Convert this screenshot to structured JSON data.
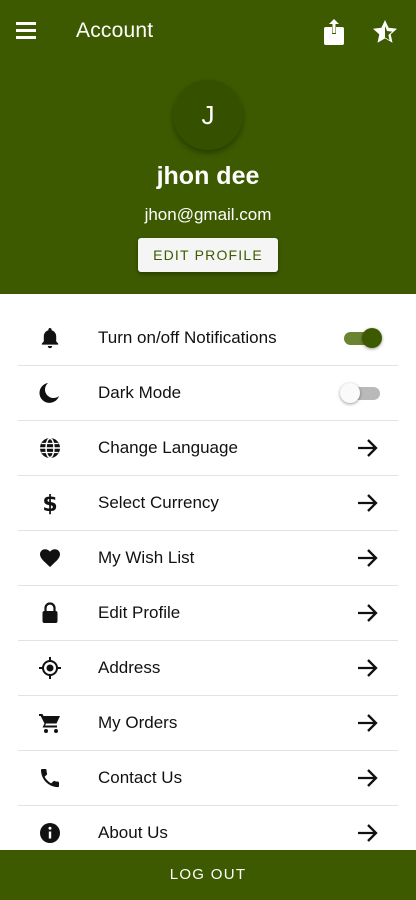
{
  "colors": {
    "primary": "#3d5a00",
    "avatar_bg": "#355100",
    "toggle_on": "#3d5a00",
    "toggle_off": "#b9b9b9"
  },
  "appbar": {
    "title": "Account",
    "icons": [
      "menu-icon",
      "share-icon",
      "star-icon"
    ]
  },
  "profile": {
    "avatar_letter": "J",
    "name": "jhon dee",
    "email": "jhon@gmail.com",
    "edit_button": "EDIT PROFILE"
  },
  "menu": {
    "items": [
      {
        "label": "Turn on/off Notifications",
        "icon": "bell-icon",
        "control": "toggle",
        "enabled": true
      },
      {
        "label": "Dark Mode",
        "icon": "moon-icon",
        "control": "toggle",
        "enabled": false
      },
      {
        "label": "Change Language",
        "icon": "globe-icon",
        "control": "arrow"
      },
      {
        "label": "Select Currency",
        "icon": "dollar-icon",
        "control": "arrow"
      },
      {
        "label": "My Wish List",
        "icon": "heart-icon",
        "control": "arrow"
      },
      {
        "label": "Edit Profile",
        "icon": "lock-icon",
        "control": "arrow"
      },
      {
        "label": "Address",
        "icon": "location-icon",
        "control": "arrow"
      },
      {
        "label": "My Orders",
        "icon": "cart-icon",
        "control": "arrow"
      },
      {
        "label": "Contact Us",
        "icon": "phone-icon",
        "control": "arrow"
      },
      {
        "label": "About Us",
        "icon": "info-icon",
        "control": "arrow"
      }
    ]
  },
  "logout": {
    "label": "LOG OUT"
  }
}
